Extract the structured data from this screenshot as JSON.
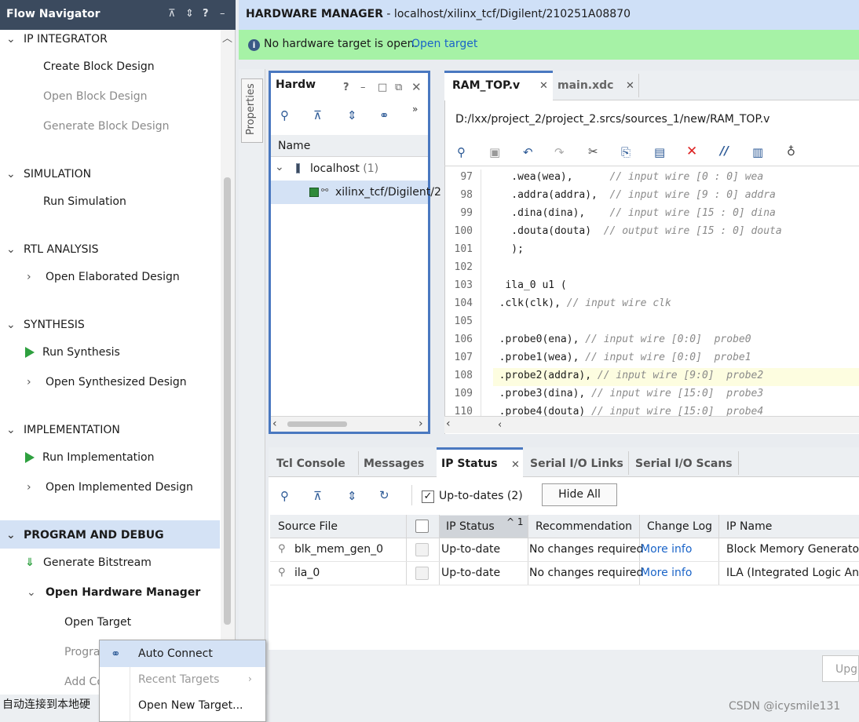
{
  "flow": {
    "title": "Flow Navigator",
    "header_icons": [
      "⊼",
      "⇕",
      "?",
      "–"
    ],
    "sections": {
      "ip_integrator": "IP INTEGRATOR",
      "simulation": "SIMULATION",
      "rtl": "RTL ANALYSIS",
      "synthesis": "SYNTHESIS",
      "implementation": "IMPLEMENTATION",
      "program_debug": "PROGRAM AND DEBUG"
    },
    "items": {
      "create_bd": "Create Block Design",
      "open_bd": "Open Block Design",
      "gen_bd": "Generate Block Design",
      "run_sim": "Run Simulation",
      "open_elab": "Open Elaborated Design",
      "run_synth": "Run Synthesis",
      "open_synth": "Open Synthesized Design",
      "run_impl": "Run Implementation",
      "open_impl": "Open Implemented Design",
      "gen_bit": "Generate Bitstream",
      "open_hw": "Open Hardware Manager",
      "open_target": "Open Target",
      "program": "Progra",
      "add_config": "Add Co"
    }
  },
  "header": {
    "title": "HARDWARE MANAGER",
    "subtitle": " - localhost/xilinx_tcf/Digilent/210251A08870"
  },
  "banner": {
    "text": "No hardware target is open.",
    "link": "Open target"
  },
  "properties_tab": "Properties",
  "hardware": {
    "tab": "Hardw",
    "column": "Name",
    "host": "localhost",
    "host_count": "(1)",
    "target": "xilinx_tcf/Digilent/2"
  },
  "editor": {
    "tabs": [
      "RAM_TOP.v",
      "main.xdc"
    ],
    "path": "D:/lxx/project_2/project_2.srcs/sources_1/new/RAM_TOP.v",
    "lines": [
      {
        "n": "97",
        "code": "    .wea(wea),      ",
        "comment": "// input wire [0 : 0] wea"
      },
      {
        "n": "98",
        "code": "    .addra(addra),  ",
        "comment": "// input wire [9 : 0] addra"
      },
      {
        "n": "99",
        "code": "    .dina(dina),    ",
        "comment": "// input wire [15 : 0] dina"
      },
      {
        "n": "100",
        "code": "    .douta(douta)  ",
        "comment": "// output wire [15 : 0] douta"
      },
      {
        "n": "101",
        "code": "    );",
        "comment": ""
      },
      {
        "n": "102",
        "code": "",
        "comment": ""
      },
      {
        "n": "103",
        "code": "   ila_0 u1 (",
        "comment": ""
      },
      {
        "n": "104",
        "code": "  .clk(clk), ",
        "comment": "// input wire clk"
      },
      {
        "n": "105",
        "code": "",
        "comment": ""
      },
      {
        "n": "106",
        "code": "  .probe0(ena), ",
        "comment": "// input wire [0:0]  probe0"
      },
      {
        "n": "107",
        "code": "  .probe1(wea), ",
        "comment": "// input wire [0:0]  probe1"
      },
      {
        "n": "108",
        "code": "  .probe2(addra), ",
        "comment": "// input wire [9:0]  probe2"
      },
      {
        "n": "109",
        "code": "  .probe3(dina), ",
        "comment": "// input wire [15:0]  probe3"
      },
      {
        "n": "110",
        "code": "  .probe4(douta) ",
        "comment": "// input wire [15:0]  probe4"
      }
    ]
  },
  "bottom": {
    "tabs": [
      "Tcl Console",
      "Messages",
      "IP Status",
      "Serial I/O Links",
      "Serial I/O Scans"
    ],
    "uptodate_label": "Up-to-dates (2)",
    "hide_all": "Hide All",
    "columns": [
      "Source File",
      "IP Status",
      "Recommendation",
      "Change Log",
      "IP Name"
    ],
    "sort_indicator": "^ 1",
    "rows": [
      {
        "source": "blk_mem_gen_0",
        "status": "Up-to-date",
        "rec": "No changes required",
        "log": "More info",
        "name": "Block Memory Generator"
      },
      {
        "source": "ila_0",
        "status": "Up-to-date",
        "rec": "No changes required",
        "log": "More info",
        "name": "ILA (Integrated Logic Analy"
      }
    ],
    "upgrade": "Upgr"
  },
  "context_menu": {
    "items": [
      "Auto Connect",
      "Recent Targets",
      "Open New Target..."
    ]
  },
  "status_bar": {
    "text": "自动连接到本地硬",
    "watermark": "CSDN @icysmile131"
  }
}
